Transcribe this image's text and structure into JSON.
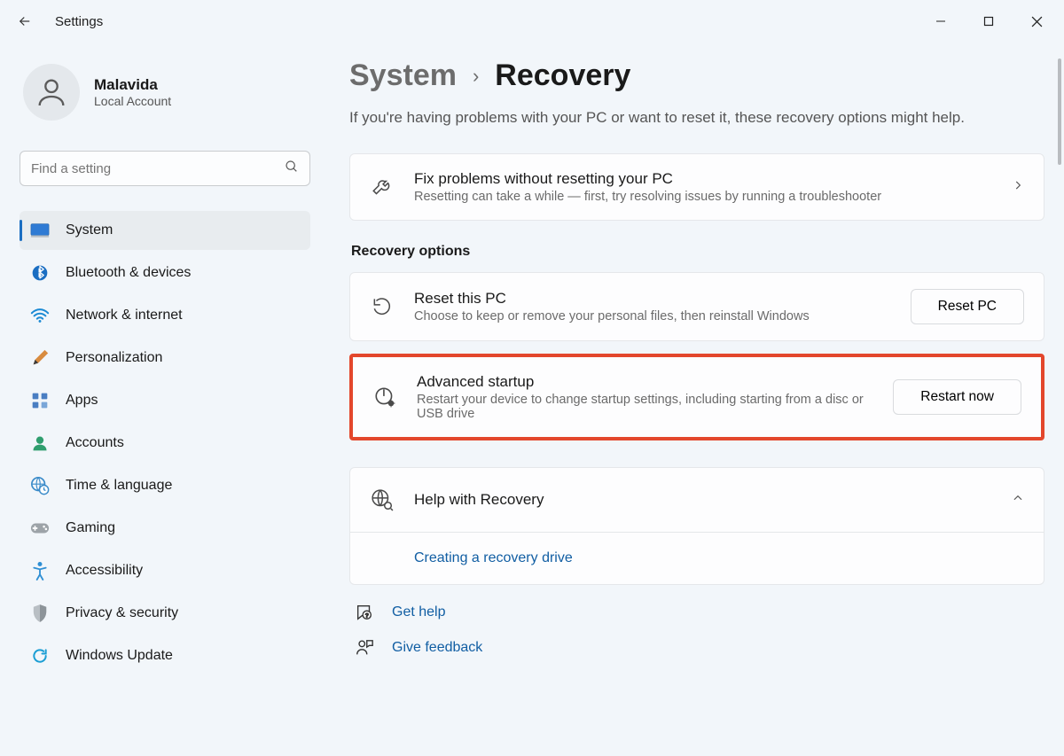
{
  "app": {
    "title": "Settings"
  },
  "user": {
    "name": "Malavida",
    "subtitle": "Local Account"
  },
  "search": {
    "placeholder": "Find a setting"
  },
  "nav": {
    "items": [
      {
        "label": "System",
        "icon": "system"
      },
      {
        "label": "Bluetooth & devices",
        "icon": "bluetooth"
      },
      {
        "label": "Network & internet",
        "icon": "wifi"
      },
      {
        "label": "Personalization",
        "icon": "brush"
      },
      {
        "label": "Apps",
        "icon": "apps"
      },
      {
        "label": "Accounts",
        "icon": "person"
      },
      {
        "label": "Time & language",
        "icon": "globe-clock"
      },
      {
        "label": "Gaming",
        "icon": "gamepad"
      },
      {
        "label": "Accessibility",
        "icon": "accessibility"
      },
      {
        "label": "Privacy & security",
        "icon": "shield"
      },
      {
        "label": "Windows Update",
        "icon": "update"
      }
    ]
  },
  "breadcrumb": {
    "parent": "System",
    "current": "Recovery"
  },
  "intro": "If you're having problems with your PC or want to reset it, these recovery options might help.",
  "fix": {
    "title": "Fix problems without resetting your PC",
    "subtitle": "Resetting can take a while — first, try resolving issues by running a troubleshooter"
  },
  "sectionHeader": "Recovery options",
  "reset": {
    "title": "Reset this PC",
    "subtitle": "Choose to keep or remove your personal files, then reinstall Windows",
    "button": "Reset PC"
  },
  "advanced": {
    "title": "Advanced startup",
    "subtitle": "Restart your device to change startup settings, including starting from a disc or USB drive",
    "button": "Restart now"
  },
  "help": {
    "title": "Help with Recovery",
    "link": "Creating a recovery drive"
  },
  "footer": {
    "getHelp": "Get help",
    "feedback": "Give feedback"
  }
}
